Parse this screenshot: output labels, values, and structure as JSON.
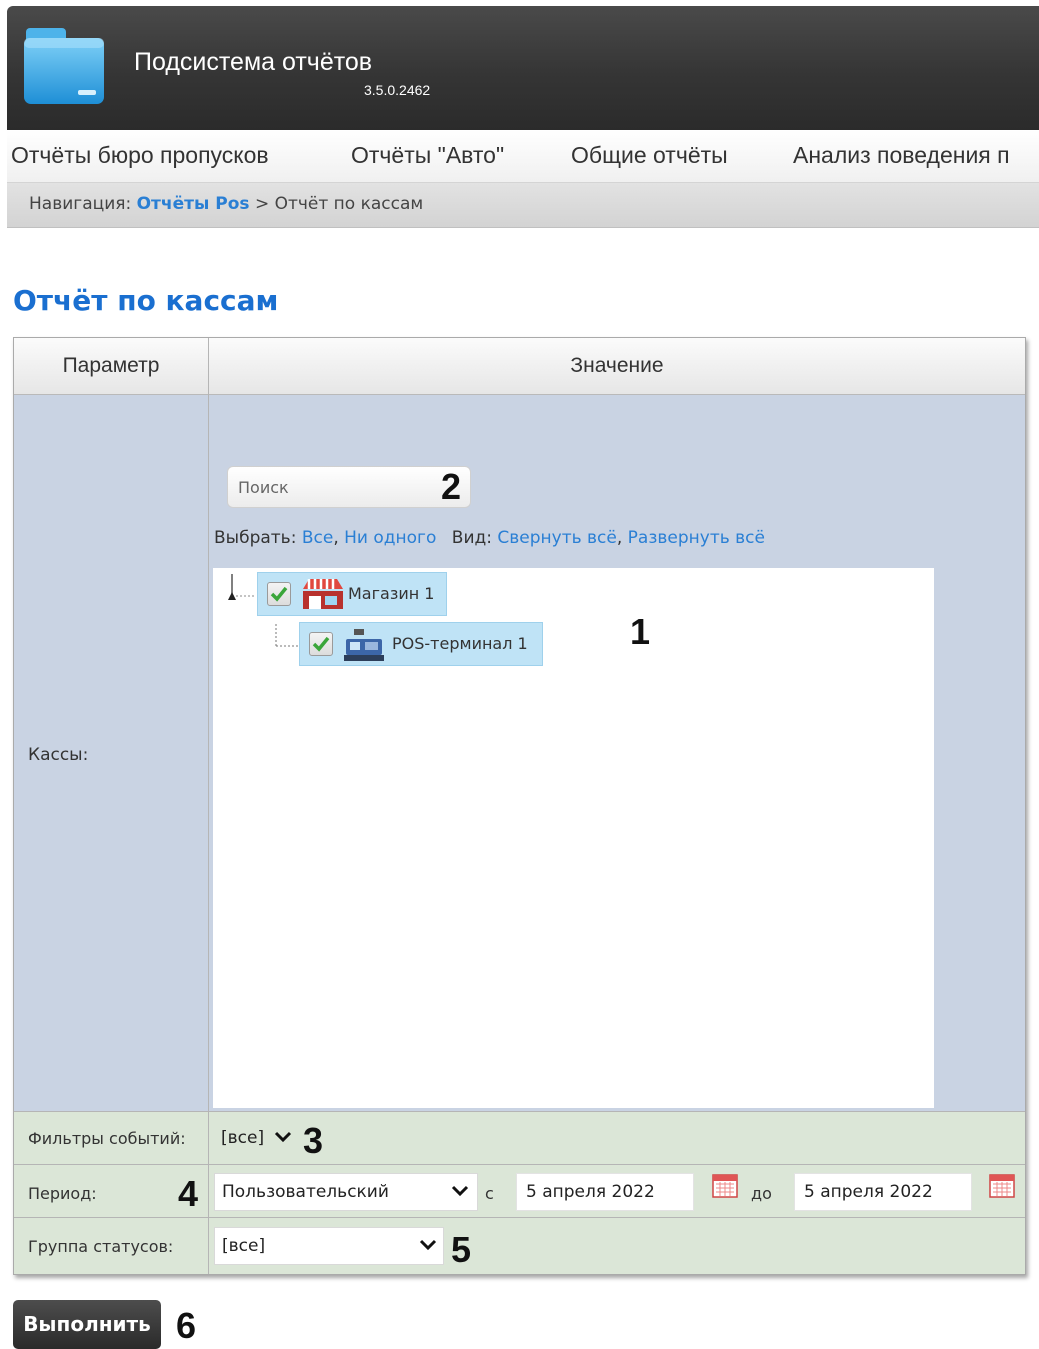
{
  "header": {
    "app_title": "Подсистема отчётов",
    "version": "3.5.0.2462"
  },
  "menu": {
    "items": [
      "Отчёты бюро пропусков",
      "Отчёты \"Авто\"",
      "Общие отчёты",
      "Анализ поведения п"
    ]
  },
  "breadcrumb": {
    "prefix": "Навигация:",
    "link": "Отчёты Pos",
    "separator": ">",
    "current": "Отчёт по кассам"
  },
  "page_title": "Отчёт по кассам",
  "table": {
    "col_param": "Параметр",
    "col_value": "Значение"
  },
  "cashboxes": {
    "label": "Кассы:",
    "search_placeholder": "Поиск",
    "select_label": "Выбрать:",
    "select_all": "Все",
    "select_none": "Ни одного",
    "view_label": "Вид:",
    "collapse_all": "Свернуть всё",
    "expand_all": "Развернуть всё",
    "tree": [
      {
        "name": "Магазин 1",
        "checked": true,
        "icon": "store-icon"
      },
      {
        "name": "POS-терминал 1",
        "checked": true,
        "icon": "pos-terminal-icon"
      }
    ]
  },
  "event_filters": {
    "label": "Фильтры событий:",
    "value": "[все]"
  },
  "period": {
    "label": "Период:",
    "type": "Пользовательский",
    "from_label": "с",
    "from": "5 апреля 2022",
    "to_label": "до",
    "to": "5 апреля 2022"
  },
  "status_group": {
    "label": "Группа статусов:",
    "value": "[все]"
  },
  "run_button": "Выполнить",
  "annotations": [
    "1",
    "2",
    "3",
    "4",
    "5",
    "6"
  ],
  "colors": {
    "link": "#2a7fd4",
    "title": "#1a6fd0",
    "header_bg": "#3a3a3a",
    "selection": "#bfe3f6",
    "row_green": "#dbe6d7",
    "value_panel": "#c9d3e3"
  }
}
